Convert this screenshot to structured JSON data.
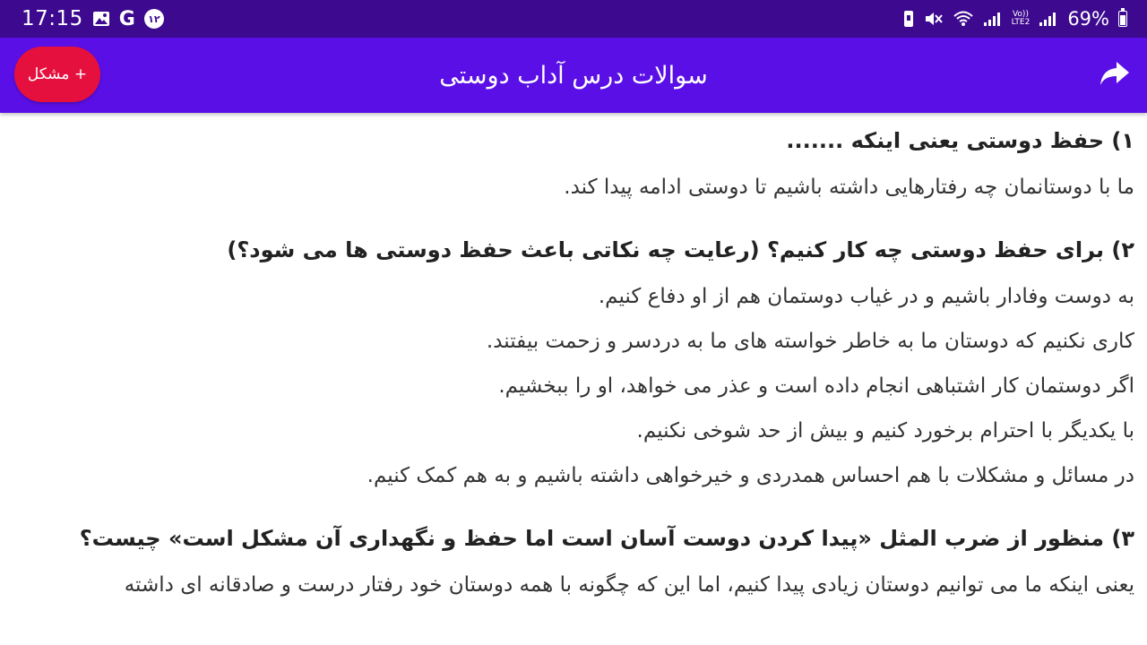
{
  "status_bar": {
    "time": "17:15",
    "badge": "۱۲",
    "g_letter": "G",
    "lte_label_top": "Vo))",
    "lte_label_bottom": "LTE2",
    "battery": "69%",
    "icons": [
      "image-icon",
      "google-icon",
      "notification-badge-icon",
      "vibrate-icon",
      "mute-icon",
      "wifi-icon",
      "signal-icon",
      "signal-icon-2",
      "battery-icon"
    ]
  },
  "app_bar": {
    "title": "سوالات درس آداب دوستی",
    "problem_button": "+ مشکل",
    "share_icon": "share-icon",
    "colors": {
      "background": "#5a0fe6",
      "button": "#e6103f",
      "status_bar": "#3d0a8f"
    }
  },
  "questions": [
    {
      "question": "۱) حفظ دوستی یعنی اینکه .......",
      "answers": [
        "ما با دوستانمان چه رفتارهایی داشته باشیم تا دوستی ادامه پیدا کند."
      ]
    },
    {
      "question": "۲) برای حفظ دوستی چه کار کنیم؟ (رعایت چه نکاتی باعث حفظ دوستی ها می شود؟)",
      "answers": [
        "به دوست وفادار باشیم و در غیاب دوستمان هم از او دفاع کنیم.",
        "کاری نکنیم که دوستان ما به خاطر خواسته های ما به دردسر و زحمت بیفتند.",
        "اگر دوستمان کار اشتباهی انجام داده است و عذر می خواهد، او را ببخشیم.",
        "با یکدیگر با احترام برخورد کنیم و بیش از حد شوخی نکنیم.",
        "در مسائل و مشکلات با هم احساس همدردی و خیرخواهی داشته باشیم و به هم کمک کنیم."
      ]
    },
    {
      "question": "۳) منظور از ضرب المثل «پیدا کردن دوست آسان است اما حفظ و نگهداری آن مشکل است» چیست؟",
      "answers": [
        "یعنی اینکه ما می توانیم دوستان زیادی پیدا کنیم، اما این که چگونه با همه دوستان خود رفتار درست و صادقانه ای داشته"
      ]
    }
  ]
}
